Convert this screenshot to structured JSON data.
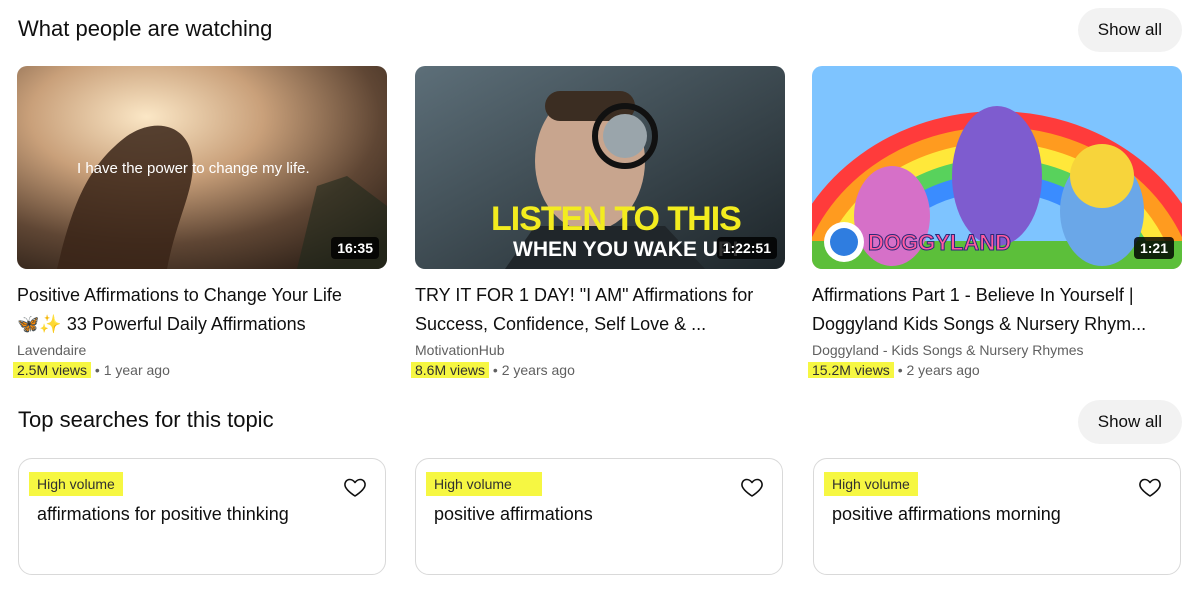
{
  "watching": {
    "title": "What people are watching",
    "show_all": "Show all",
    "videos": [
      {
        "title_line1": "Positive Affirmations to Change Your Life",
        "title_line2": "🦋✨ 33 Powerful Daily Affirmations",
        "channel": "Lavendaire",
        "views": "2.5M views",
        "age": "1 year ago",
        "duration": "16:35",
        "thumb_text": "I have the power to change my life."
      },
      {
        "title_line1": "TRY IT FOR 1 DAY! \"I AM\" Affirmations for",
        "title_line2": "Success, Confidence, Self Love & ...",
        "channel": "MotivationHub",
        "views": "8.6M views",
        "age": "2 years ago",
        "duration": "1:22:51",
        "thumb_text_1": "LISTEN TO THIS",
        "thumb_text_2": "WHEN YOU WAKE UP!"
      },
      {
        "title_line1": "Affirmations Part 1 - Believe In Yourself |",
        "title_line2": "Doggyland Kids Songs & Nursery Rhym...",
        "channel": "Doggyland - Kids Songs & Nursery Rhymes",
        "views": "15.2M views",
        "age": "2 years ago",
        "duration": "1:21",
        "thumb_text": "DOGGYLAND"
      }
    ]
  },
  "searches": {
    "title": "Top searches for this topic",
    "show_all": "Show all",
    "items": [
      {
        "badge": "High volume",
        "query": "affirmations for positive thinking"
      },
      {
        "badge": "High volume",
        "query": "positive affirmations"
      },
      {
        "badge": "High volume",
        "query": "positive affirmations morning"
      }
    ]
  },
  "colors": {
    "highlight": "#f6f742",
    "secondary_text": "#606060",
    "button_bg": "#f2f2f2"
  },
  "icons": {
    "favorite": "heart-icon"
  }
}
